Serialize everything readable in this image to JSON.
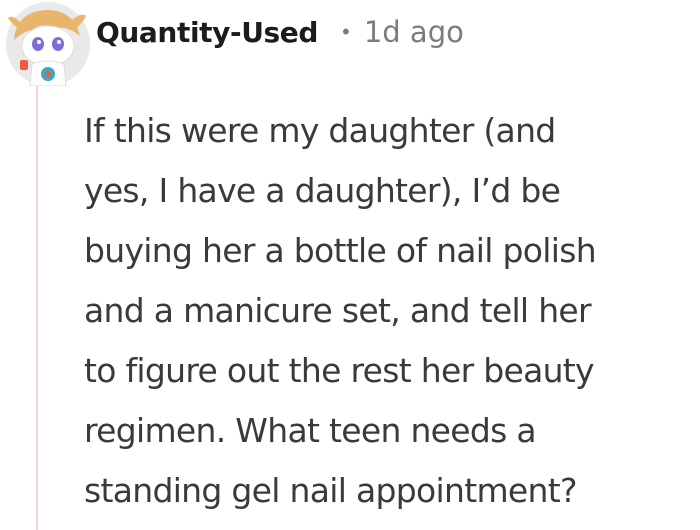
{
  "comment": {
    "author": "Quantity-Used",
    "separator": "•",
    "timestamp": "1d ago",
    "avatar_icon": "reddit-snoo-avatar-icon",
    "body_lines": [
      "If this were my daughter (and",
      "yes, I have a daughter), I’d be",
      "buying her a bottle of nail polish",
      "and a manicure set, and tell her",
      "to figure out the rest her beauty",
      "regimen. What teen needs a",
      "standing gel nail appointment?"
    ]
  },
  "colors": {
    "username": "#1c1c1c",
    "meta": "#7c7c7c",
    "body": "#3a3a3a",
    "thread_line": "#f2d6d3",
    "avatar_bg": "#e9e9e9"
  }
}
